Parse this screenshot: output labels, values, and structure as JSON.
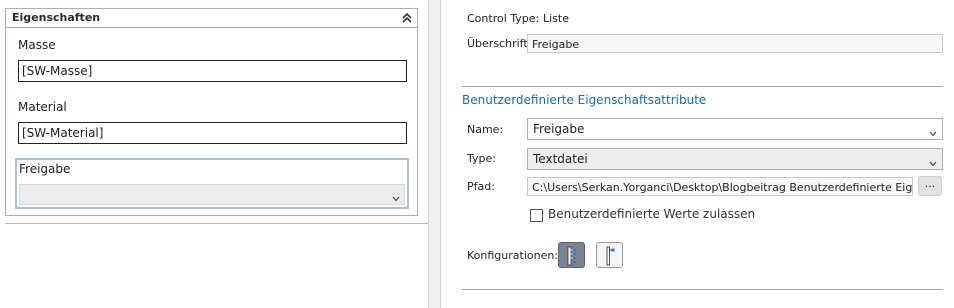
{
  "left": {
    "group_title": "Eigenschaften",
    "fields": [
      {
        "label": "Masse",
        "value": "[SW-Masse]"
      },
      {
        "label": "Material",
        "value": "[SW-Material]"
      }
    ],
    "freigabe": {
      "label": "Freigabe",
      "value": ""
    }
  },
  "right": {
    "control_type_label": "Control Type:",
    "control_type_value": "Liste",
    "caption_label": "Überschrift:",
    "caption_value": "Freigabe",
    "section_title": "Benutzerdefinierte Eigenschaftsattribute",
    "name_label": "Name:",
    "name_value": "Freigabe",
    "type_label": "Type:",
    "type_value": "Textdatei",
    "path_label": "Pfad:",
    "path_value": "C:\\Users\\Serkan.Yorganci\\Desktop\\Blogbeitrag Benutzerdefinierte Eigenschaften",
    "browse_label": "...",
    "custom_values_label": "Benutzerdefinierte Werte zulassen",
    "configurations_label": "Konfigurationen:"
  },
  "colors": {
    "accent_blue": "#1b6aa5",
    "group_border": "#a8acc8",
    "focus_border": "#aac2d2"
  },
  "icons": {
    "collapse": "double-chevron-up-icon",
    "dropdown": "chevron-down-icon",
    "config_all": "config-all-icon",
    "config_specific": "config-specific-icon"
  }
}
